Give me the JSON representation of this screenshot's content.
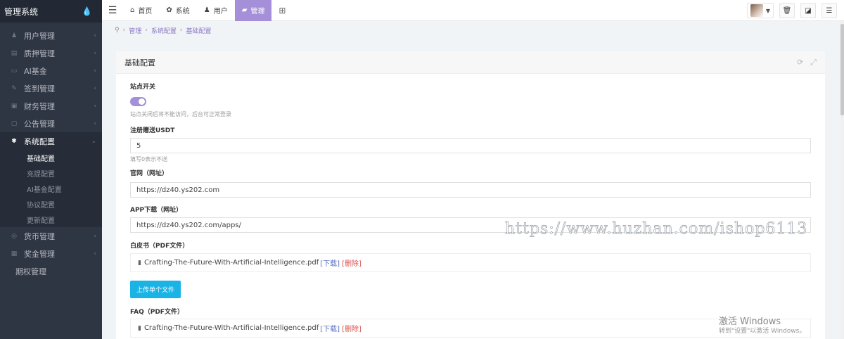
{
  "sidebar": {
    "title": "管理系统",
    "items": [
      {
        "label": "用户管理",
        "icon": "user-icon",
        "glyph": "♟"
      },
      {
        "label": "质押管理",
        "icon": "list-icon",
        "glyph": "▤"
      },
      {
        "label": "AI基金",
        "icon": "monitor-icon",
        "glyph": "▭"
      },
      {
        "label": "签到管理",
        "icon": "edit-icon",
        "glyph": "✎"
      },
      {
        "label": "财务管理",
        "icon": "money-icon",
        "glyph": "▣"
      },
      {
        "label": "公告管理",
        "icon": "file-icon",
        "glyph": "▢"
      },
      {
        "label": "系统配置",
        "icon": "cogs-icon",
        "glyph": "✱"
      }
    ],
    "sub_items": [
      "基础配置",
      "充提配置",
      "AI基金配置",
      "协议配置",
      "更新配置"
    ],
    "items_after": [
      {
        "label": "货币管理",
        "icon": "coin-icon",
        "glyph": "◎"
      },
      {
        "label": "奖金管理",
        "icon": "gift-icon",
        "glyph": "▦"
      }
    ],
    "plain_item": "期权管理"
  },
  "topbar": {
    "tabs": [
      {
        "label": "首页",
        "glyph": "⌂"
      },
      {
        "label": "系统",
        "glyph": "✿"
      },
      {
        "label": "用户",
        "glyph": "♟"
      },
      {
        "label": "管理",
        "glyph": "▰"
      }
    ]
  },
  "breadcrumb": [
    "管理",
    "系统配置",
    "基础配置"
  ],
  "panel": {
    "title": "基础配置",
    "site_switch_label": "站点开关",
    "site_switch_on": true,
    "site_switch_help": "站点关闭后将不能访问，后台可正常登录",
    "reg_gift_label": "注册赠送USDT",
    "reg_gift_value": "5",
    "reg_gift_help": "填写0表示不送",
    "website_label": "官网（网址）",
    "website_value": "https://dz40.ys202.com",
    "app_label": "APP下载（网址）",
    "app_value": "https://dz40.ys202.com/apps/",
    "whitepaper_label": "白皮书（PDF文件）",
    "whitepaper_file": "Crafting-The-Future-With-Artificial-Intelligence.pdf",
    "download_text": "[下载]",
    "delete_text": "[删除]",
    "upload_label": "上传单个文件",
    "faq_label": "FAQ（PDF文件）",
    "faq_file": "Crafting-The-Future-With-Artificial-Intelligence.pdf"
  },
  "watermark": "https://www.huzhan.com/ishop6113",
  "windows_activation": {
    "title": "激活 Windows",
    "subtitle": "转到\"设置\"以激活 Windows。"
  }
}
